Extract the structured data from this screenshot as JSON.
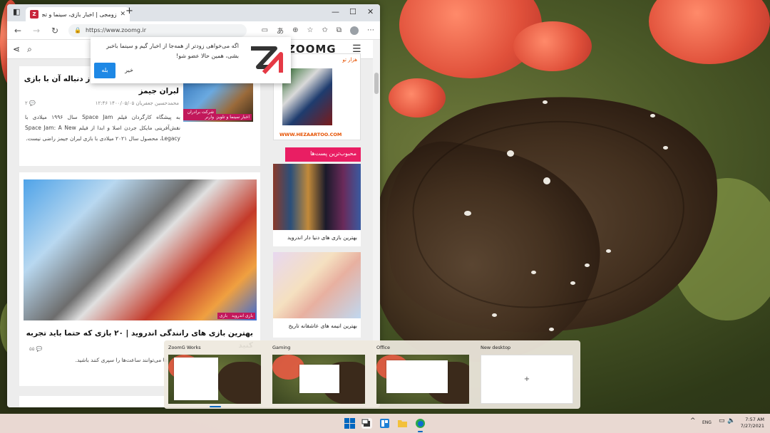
{
  "browser": {
    "tab_title": "زومجی | اخبار بازی، سینما و تجربه",
    "url": "https://www.zoomg.ir"
  },
  "site": {
    "logo": "ZOOMG",
    "popup": {
      "text": "اگه می‌خواهی زودتر از همه‌جا از اخبار گیم و سینما باخبر بشی، همین حالا عضو شو!",
      "yes": "بله",
      "no": "خیر"
    },
    "posts": [
      {
        "title": "Space Jam سال ۱۹۹۶ از دنباله آن با بازی لبران جیمز",
        "title_latin": "Space Ja",
        "meta": "محمدحسین جعفریان  ۱۴۰۰/۰۵/۰۵ ۱۲:۴۶",
        "comments": "۲",
        "excerpt": "به پیشگاه کارگردان فیلم Space Jam سال ۱۹۹۶ میلادی با نقش‌آفرینی مایکل جردن اصلا و ابدا از فیلم Space Jam: A New Legacy، محصول سال ۲۰۲۱ میلادی با بازی لبران جیمز راضی نیست.",
        "tags": [
          "اخبار سینما و تلویزیون",
          "شرکت برادران وارنر"
        ]
      },
      {
        "title": "بهترین بازی های رانندگی اندروید | ۲۰ بازی که حتما باید تجربه کنید",
        "comments": "۵۵",
        "excerpt": "سینگ اندروید واقعا هر که هرکدام از آن‌ها می‌توانند ساعت‌ها را سپری کنند باشید.",
        "tags": [
          "بازی اندروید",
          "بازی"
        ]
      }
    ],
    "sidebar": {
      "ad_url": "WWW.HEZAARTOO.COM",
      "ad_label": "هزار تو",
      "popular_heading": "محبوب‌ترین پست‌ها",
      "popular": [
        "بهترین بازی های دنیا دار اندروید",
        "بهترین انیمه های عاشقانه تاریخ"
      ]
    }
  },
  "taskview": {
    "desktops": [
      {
        "label": "ZoomG Works"
      },
      {
        "label": "Gaming"
      },
      {
        "label": "Office"
      },
      {
        "label": "New desktop",
        "icon": "plus-icon",
        "symbol": "+"
      }
    ]
  },
  "taskbar": {
    "language": "ENG",
    "time": "7:57 AM",
    "date": "7/27/2021",
    "accent": "#0067c0"
  }
}
